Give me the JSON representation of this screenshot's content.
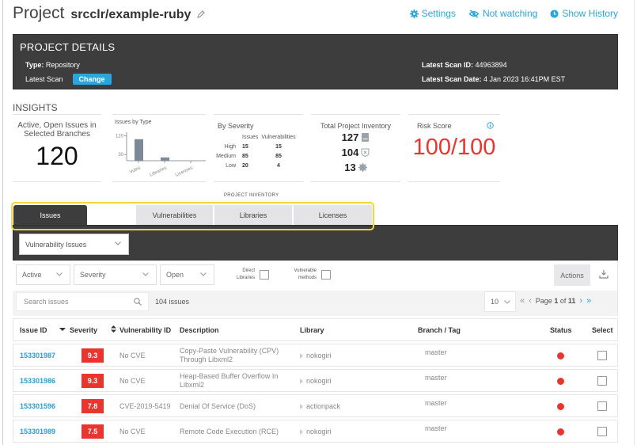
{
  "header": {
    "title_prefix": "Project",
    "project_name": "srcclr/example-ruby",
    "links": [
      {
        "label": "Settings",
        "icon": "gear-icon"
      },
      {
        "label": "Not watching",
        "icon": "eye-slash-icon"
      },
      {
        "label": "Show History",
        "icon": "clock-icon"
      }
    ]
  },
  "details": {
    "title": "PROJECT DETAILS",
    "type_label": "Type:",
    "type_value": "Repository",
    "latest_scan_label": "Latest Scan",
    "change_label": "Change",
    "scan_id_label": "Latest Scan ID:",
    "scan_id_value": "44963894",
    "scan_date_label": "Latest Scan Date:",
    "scan_date_value": "4 Jan 2023 16:41PM EST"
  },
  "insights": {
    "title": "INSIGHTS",
    "active_issues": {
      "label": "Active, Open Issues in Selected Branches",
      "value": "120"
    },
    "issues_by_type": {
      "label": "Issues by Type"
    },
    "by_severity": {
      "label": "By Severity",
      "col_issues": "Issues",
      "col_vulns": "Vulnerabilities",
      "rows": [
        {
          "level": "High",
          "issues": "15",
          "vulns": "15"
        },
        {
          "level": "Medium",
          "issues": "85",
          "vulns": "85"
        },
        {
          "level": "Low",
          "issues": "20",
          "vulns": "4"
        }
      ]
    },
    "inventory": {
      "label": "Total Project Inventory",
      "items": [
        {
          "value": "127",
          "icon": "library-icon"
        },
        {
          "value": "104",
          "icon": "shield-x-icon"
        },
        {
          "value": "13",
          "icon": "license-badge-icon"
        }
      ]
    },
    "risk": {
      "label": "Risk Score",
      "value": "100/100",
      "color": "#e8362f"
    }
  },
  "chart_data": {
    "type": "bar",
    "title": "Issues by Type",
    "categories": [
      "Vulns",
      "Libraries",
      "Licenses"
    ],
    "values": [
      104,
      16,
      0
    ],
    "yticks": [
      30,
      120
    ],
    "ylim": [
      0,
      130
    ],
    "xlabel": "",
    "ylabel": "",
    "bar_color": "#7b8a96"
  },
  "tabs": {
    "section_label": "PROJECT INVENTORY",
    "items": [
      "Issues",
      "Vulnerabilities",
      "Libraries",
      "Licenses"
    ],
    "active": "Issues"
  },
  "issue_type_select": "Vulnerability Issues",
  "filters": {
    "active": "Active",
    "severity": "Severity",
    "open": "Open",
    "direct_libraries_label_1": "Direct",
    "direct_libraries_label_2": "Libraries",
    "vulnerable_methods_label_1": "Vulnerable",
    "vulnerable_methods_label_2": "methods",
    "actions_label": "Actions"
  },
  "search": {
    "placeholder": "Search issues",
    "count": "104 issues",
    "per_page": "10",
    "page_label": "Page",
    "page_current": "1",
    "page_of": "of",
    "page_total": "11"
  },
  "table": {
    "columns": [
      "Issue ID",
      "Severity",
      "Vulnerability ID",
      "Description",
      "Library",
      "Branch / Tag",
      "Status",
      "Select"
    ],
    "rows": [
      {
        "id": "153301987",
        "severity": "9.3",
        "vuln_id": "No CVE",
        "desc1": "Copy-Paste Vulnerability (CPV)",
        "desc2": "Through Libxml2",
        "library": "nokogiri",
        "branch": "master",
        "status_color": "#e8362f"
      },
      {
        "id": "153301986",
        "severity": "9.3",
        "vuln_id": "No CVE",
        "desc1": "Heap-Based Buffer Overflow In",
        "desc2": "Libxml2",
        "library": "nokogiri",
        "branch": "master",
        "status_color": "#e8362f"
      },
      {
        "id": "153301596",
        "severity": "7.8",
        "vuln_id": "CVE-2019-5419",
        "desc1": "Denial Of Service (DoS)",
        "desc2": "",
        "library": "actionpack",
        "branch": "master",
        "status_color": "#e8362f"
      },
      {
        "id": "153301989",
        "severity": "7.5",
        "vuln_id": "No CVE",
        "desc1": "Remote Code Execution (RCE)",
        "desc2": "",
        "library": "nokogiri",
        "branch": "master",
        "status_color": "#e8362f"
      }
    ]
  }
}
